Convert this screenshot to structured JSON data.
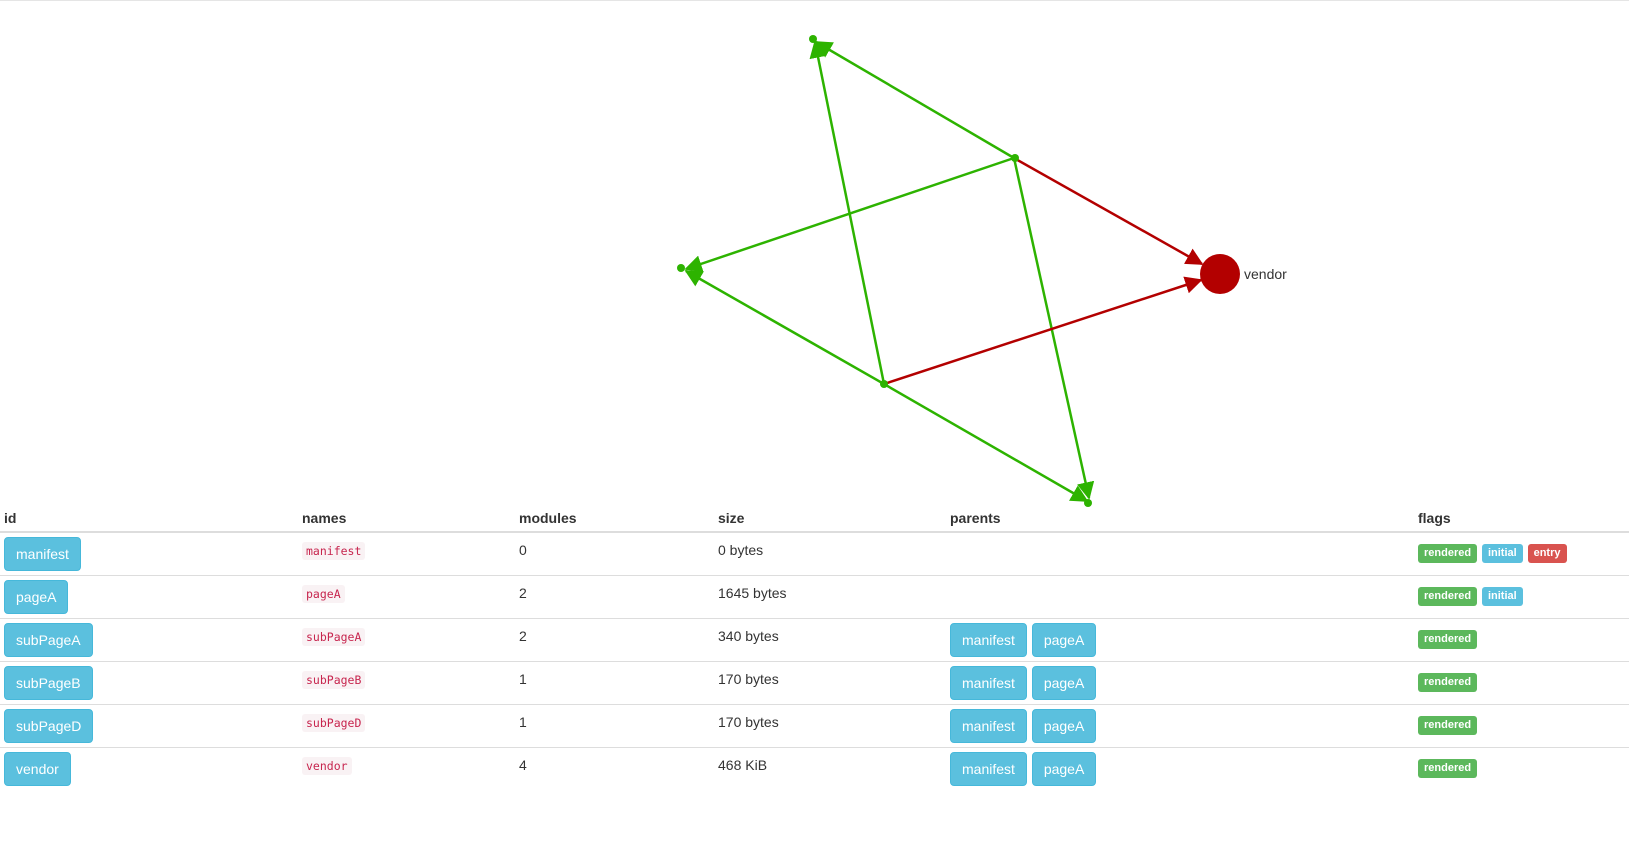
{
  "graph": {
    "vendor_label": "vendor",
    "colors": {
      "edge_green": "#2db300",
      "edge_red": "#b30000",
      "node_green": "#2db300",
      "node_red": "#b30000"
    }
  },
  "table": {
    "headers": {
      "id": "id",
      "names": "names",
      "modules": "modules",
      "size": "size",
      "parents": "parents",
      "flags": "flags"
    },
    "rows": [
      {
        "id": "manifest",
        "name": "manifest",
        "modules": "0",
        "size": "0 bytes",
        "parents": [],
        "flags": [
          "rendered",
          "initial",
          "entry"
        ]
      },
      {
        "id": "pageA",
        "name": "pageA",
        "modules": "2",
        "size": "1645 bytes",
        "parents": [],
        "flags": [
          "rendered",
          "initial"
        ]
      },
      {
        "id": "subPageA",
        "name": "subPageA",
        "modules": "2",
        "size": "340 bytes",
        "parents": [
          "manifest",
          "pageA"
        ],
        "flags": [
          "rendered"
        ]
      },
      {
        "id": "subPageB",
        "name": "subPageB",
        "modules": "1",
        "size": "170 bytes",
        "parents": [
          "manifest",
          "pageA"
        ],
        "flags": [
          "rendered"
        ]
      },
      {
        "id": "subPageD",
        "name": "subPageD",
        "modules": "1",
        "size": "170 bytes",
        "parents": [
          "manifest",
          "pageA"
        ],
        "flags": [
          "rendered"
        ]
      },
      {
        "id": "vendor",
        "name": "vendor",
        "modules": "4",
        "size": "468 KiB",
        "parents": [
          "manifest",
          "pageA"
        ],
        "flags": [
          "rendered"
        ]
      }
    ]
  }
}
